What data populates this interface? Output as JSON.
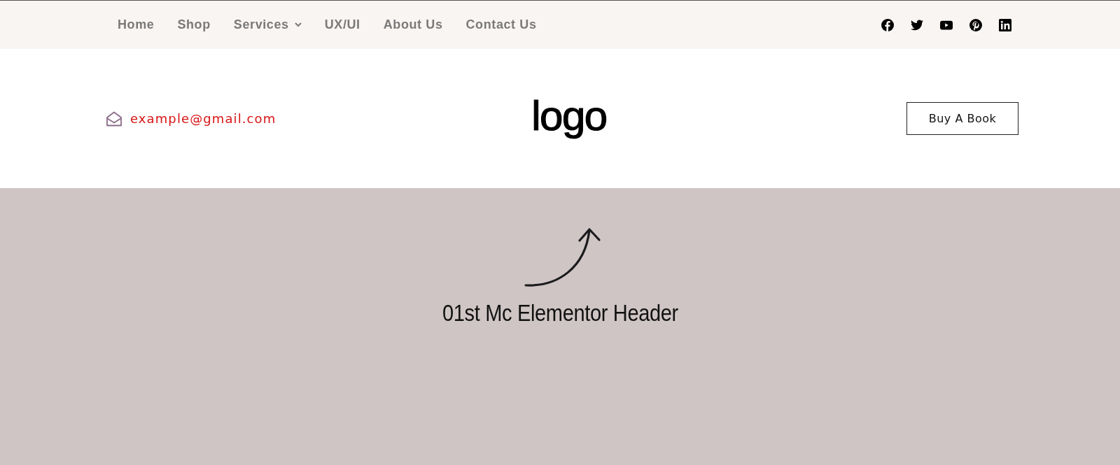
{
  "top_nav": {
    "items": [
      {
        "label": "Home",
        "kind": "link"
      },
      {
        "label": "Shop",
        "kind": "link"
      },
      {
        "label": "Services",
        "kind": "dropdown"
      },
      {
        "label": "UX/UI",
        "kind": "link"
      },
      {
        "label": "About Us",
        "kind": "link"
      },
      {
        "label": "Contact Us",
        "kind": "link"
      }
    ]
  },
  "header": {
    "email": "example@gmail.com",
    "logo": "logo",
    "button": "Buy A Book"
  },
  "hero": {
    "title": "01st Mc Elementor Header"
  }
}
